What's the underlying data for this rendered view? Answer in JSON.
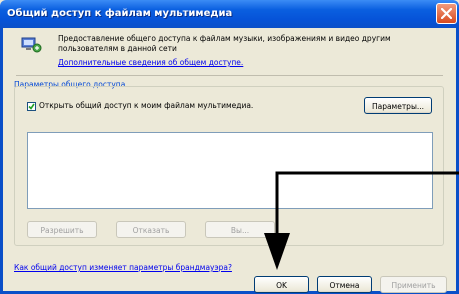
{
  "window": {
    "title": "Общий доступ к файлам мультимедиа",
    "close_glyph": "✕"
  },
  "intro": {
    "description": "Предоставление общего доступа к файлам музыки, изображениям и видео другим пользователям в данной сети",
    "more_link": "Дополнительные сведения об общем доступе."
  },
  "sharing_group": {
    "label": "Параметры общего доступа",
    "share_checkbox_label": "Открыть общий доступ к моим файлам мультимедиа.",
    "share_checked": true,
    "params_button": "Параметры...",
    "devices_list": [],
    "allow_button": "Разрешить",
    "deny_button": "Отказать",
    "other_button": "Вы..."
  },
  "footer": {
    "firewall_link": "Как общий доступ изменяет параметры брандмауэра?",
    "ok_button": "OK",
    "cancel_button": "Отмена",
    "apply_button": "Применить"
  },
  "colors": {
    "titlebar": "#0653d8",
    "link": "#0000ee",
    "group_label": "#0046d5",
    "close": "#d84a1f"
  }
}
